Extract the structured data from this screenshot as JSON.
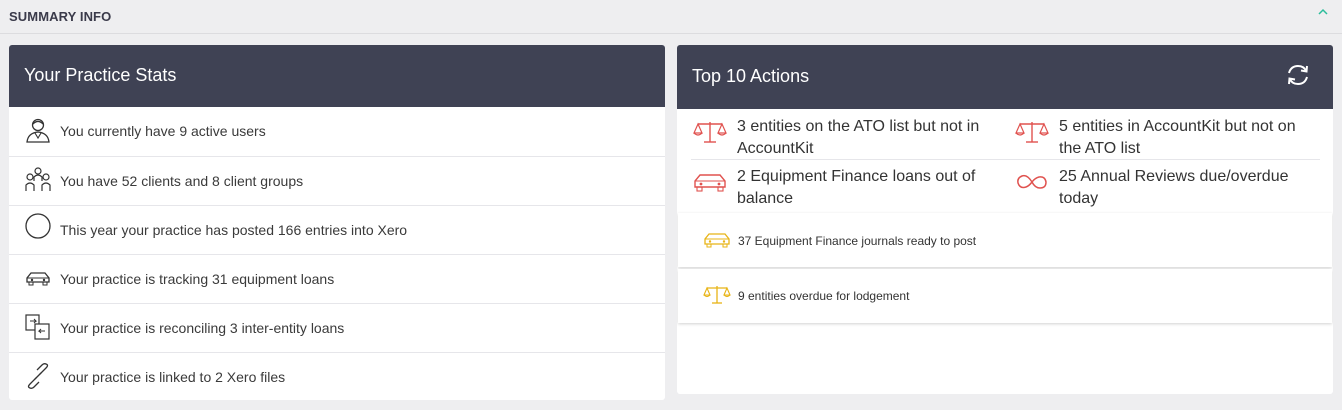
{
  "summary": {
    "title": "SUMMARY INFO",
    "collapse_icon": "chevron-up-icon"
  },
  "practice_stats": {
    "title": "Your Practice Stats",
    "items": [
      {
        "icon": "user-icon",
        "text": "You currently have 9 active users"
      },
      {
        "icon": "group-icon",
        "text": "You have 52 clients and 8 client groups"
      },
      {
        "icon": "circle-icon",
        "text": "This year your practice has posted 166 entries into Xero"
      },
      {
        "icon": "car-icon",
        "text": "Your practice is tracking 31 equipment loans"
      },
      {
        "icon": "transfer-icon",
        "text": "Your practice is reconciling 3 inter-entity loans"
      },
      {
        "icon": "link-icon",
        "text": "Your practice is linked to 2 Xero files"
      }
    ]
  },
  "top_actions": {
    "title": "Top 10 Actions",
    "refresh_icon": "refresh-icon",
    "primary": [
      {
        "icon": "scales-icon",
        "text": "3 entities on the ATO list but not in AccountKit"
      },
      {
        "icon": "scales-icon",
        "text": "5 entities in AccountKit but not on the ATO list"
      },
      {
        "icon": "car-icon",
        "text": "2 Equipment Finance loans out of balance"
      },
      {
        "icon": "infinity-icon",
        "text": "25 Annual Reviews due/overdue today"
      }
    ],
    "secondary": [
      {
        "icon": "car-icon",
        "text": "37 Equipment Finance journals ready to post"
      },
      {
        "icon": "scales-icon",
        "text": "9 entities overdue for lodgement"
      }
    ]
  },
  "colors": {
    "header_bg": "#3f4254",
    "danger": "#e0524f",
    "warning": "#e8b416",
    "accent": "#2bbd9b"
  }
}
